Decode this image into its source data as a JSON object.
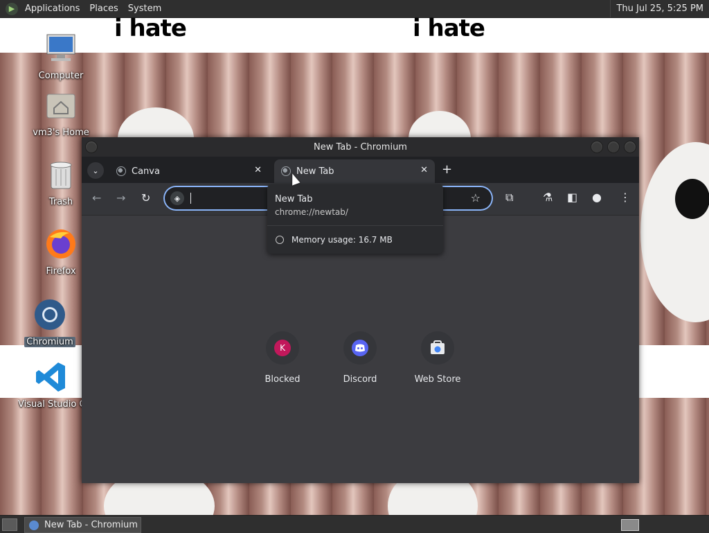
{
  "top_panel": {
    "menus": [
      "Applications",
      "Places",
      "System"
    ],
    "clock": "Thu Jul 25,  5:25 PM"
  },
  "wallpaper": {
    "text_left": "i hate",
    "text_right": "i hate"
  },
  "desktop_icons": {
    "computer": "Computer",
    "home": "vm3's Home",
    "trash": "Trash",
    "firefox": "Firefox",
    "chromium": "Chromium",
    "vscode": "Visual Studio Co"
  },
  "window": {
    "title": "New Tab - Chromium",
    "tabs": [
      {
        "label": "Canva",
        "active": false
      },
      {
        "label": "New Tab",
        "active": true
      }
    ],
    "omnibox_value": "",
    "hover_card": {
      "title": "New Tab",
      "url": "chrome://newtab/",
      "memory": "Memory usage: 16.7 MB"
    },
    "shortcuts": [
      {
        "label": "Blocked",
        "icon": "K"
      },
      {
        "label": "Discord",
        "icon": "discord-icon"
      },
      {
        "label": "Web Store",
        "icon": "web-store-icon"
      }
    ]
  },
  "taskbar": {
    "task_label": "New Tab - Chromium"
  },
  "colors": {
    "accent": "#8ab4f8",
    "blocked_avatar": "#c2185b",
    "discord": "#5865f2"
  }
}
